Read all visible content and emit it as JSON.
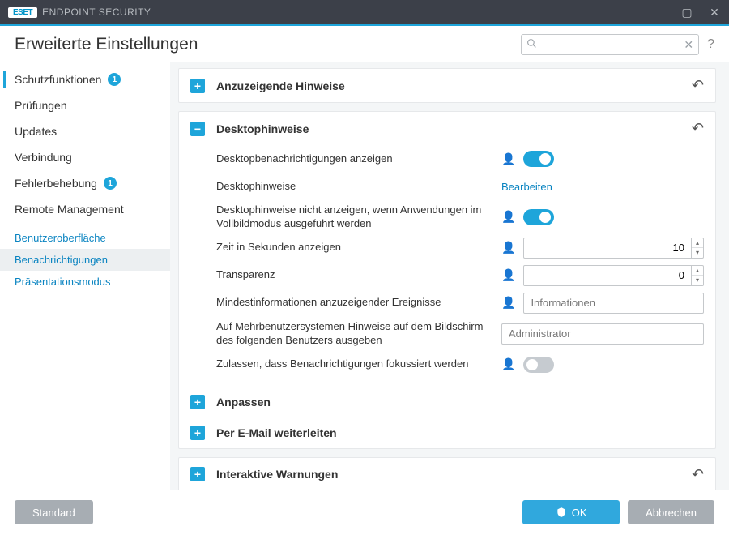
{
  "window": {
    "brand": "ESET",
    "product": "ENDPOINT SECURITY"
  },
  "header": {
    "title": "Erweiterte Einstellungen",
    "search_placeholder": "",
    "help": "?"
  },
  "sidebar": {
    "items": [
      {
        "label": "Schutzfunktionen",
        "badge": "1",
        "active": true
      },
      {
        "label": "Prüfungen"
      },
      {
        "label": "Updates"
      },
      {
        "label": "Verbindung"
      },
      {
        "label": "Fehlerbehebung",
        "badge": "1"
      },
      {
        "label": "Remote Management"
      }
    ],
    "sub": [
      {
        "label": "Benutzeroberfläche"
      },
      {
        "label": "Benachrichtigungen",
        "selected": true
      },
      {
        "label": "Präsentationsmodus"
      }
    ]
  },
  "panels": {
    "p1": {
      "title": "Anzuzeigende Hinweise"
    },
    "p2": {
      "title": "Desktophinweise",
      "rows": {
        "show_desktop": {
          "label": "Desktopbenachrichtigungen anzeigen",
          "on": true
        },
        "hints": {
          "label": "Desktophinweise",
          "link": "Bearbeiten"
        },
        "fullscreen": {
          "label": "Desktophinweise nicht anzeigen, wenn Anwendungen im Vollbildmodus ausgeführt werden",
          "on": true
        },
        "seconds": {
          "label": "Zeit in Sekunden anzeigen",
          "value": "10"
        },
        "transparency": {
          "label": "Transparenz",
          "value": "0"
        },
        "min_info": {
          "label": "Mindestinformationen anzuzeigender Ereignisse",
          "value": "Informationen"
        },
        "multiuser": {
          "label": "Auf Mehrbenutzersystemen Hinweise auf dem Bildschirm des folgenden Benutzers ausgeben",
          "value": "Administrator"
        },
        "focus": {
          "label": "Zulassen, dass Benachrichtigungen fokussiert werden",
          "on": false
        }
      },
      "sub1": "Anpassen",
      "sub2": "Per E-Mail weiterleiten"
    },
    "p3": {
      "title": "Interaktive Warnungen"
    }
  },
  "footer": {
    "default": "Standard",
    "ok": "OK",
    "cancel": "Abbrechen"
  }
}
